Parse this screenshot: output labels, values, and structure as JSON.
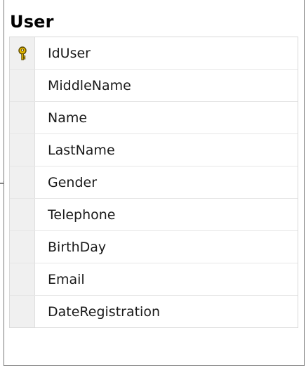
{
  "table": {
    "title": "User",
    "columns": [
      {
        "name": "IdUser",
        "primary_key": true
      },
      {
        "name": "MiddleName",
        "primary_key": false
      },
      {
        "name": "Name",
        "primary_key": false
      },
      {
        "name": "LastName",
        "primary_key": false
      },
      {
        "name": "Gender",
        "primary_key": false
      },
      {
        "name": "Telephone",
        "primary_key": false
      },
      {
        "name": "BirthDay",
        "primary_key": false
      },
      {
        "name": "Email",
        "primary_key": false
      },
      {
        "name": "DateRegistration",
        "primary_key": false
      }
    ]
  },
  "icons": {
    "primary_key": "key-icon",
    "relationship": "relationship-connector-icon"
  },
  "colors": {
    "key_fill": "#e6b800",
    "key_stroke": "#5c4a00",
    "border": "#7a7a7a"
  }
}
